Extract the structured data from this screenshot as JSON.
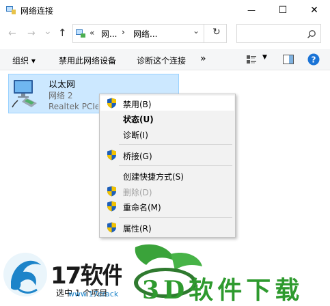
{
  "window": {
    "title": "网络连接",
    "minimize": "—",
    "maximize": "☐",
    "close": "✕"
  },
  "nav": {
    "back": "←",
    "forward": "→",
    "dropdown": "⌄",
    "up": "↑",
    "address_parts": [
      "«",
      "网...",
      "›",
      "网络..."
    ],
    "refresh": "↻",
    "search_placeholder": ""
  },
  "toolbar": {
    "organize": "组织 ▾",
    "disable_device": "禁用此网络设备",
    "diagnose": "诊断这个连接",
    "more": "»"
  },
  "item": {
    "name": "以太网",
    "network": "网络 2",
    "device": "Realtek PCIe"
  },
  "context_menu": {
    "items": [
      {
        "label": "禁用(B)"
      },
      {
        "label": "状态(U)"
      },
      {
        "label": "诊断(I)"
      },
      {
        "label": "桥接(G)"
      },
      {
        "label": "创建快捷方式(S)"
      },
      {
        "label": "删除(D)"
      },
      {
        "label": "重命名(M)"
      },
      {
        "label": "属性(R)"
      }
    ]
  },
  "status": {
    "selection": "选中 1 个项目"
  },
  "watermark": {
    "left_brand": "17软件下",
    "left_url": "www.17crack",
    "right_brand": "3D软件下载"
  },
  "colors": {
    "accent": "#0078d7",
    "selection_bg": "#cce8ff",
    "help": "#1a73d6",
    "watermark_green": "#2e9a2e"
  }
}
